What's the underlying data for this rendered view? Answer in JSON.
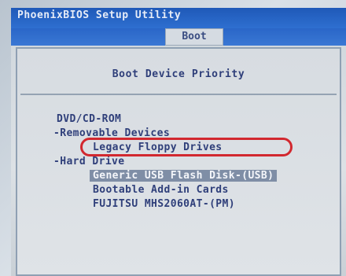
{
  "window": {
    "title": "PhoenixBIOS Setup Utility"
  },
  "menu": {
    "active_tab": "Boot"
  },
  "boot_priority": {
    "heading": "Boot Device Priority",
    "items": [
      {
        "label": "DVD/CD-ROM",
        "level": 0,
        "selected": false
      },
      {
        "label": "-Removable Devices",
        "level": 0,
        "selected": false
      },
      {
        "label": "Legacy Floppy Drives",
        "level": 1,
        "selected": false
      },
      {
        "label": "-Hard Drive",
        "level": 0,
        "selected": false
      },
      {
        "label": "Generic USB Flash Disk-(USB)",
        "level": 1,
        "selected": true
      },
      {
        "label": "Bootable Add-in Cards",
        "level": 1,
        "selected": false
      },
      {
        "label": "FUJITSU MHS2060AT-(PM)",
        "level": 1,
        "selected": false
      }
    ]
  },
  "colors": {
    "title_bar": "#2e6fd0",
    "text": "#2f3f7a",
    "selection_bg": "#7f8ea6",
    "highlight_ring": "#d2282f"
  }
}
